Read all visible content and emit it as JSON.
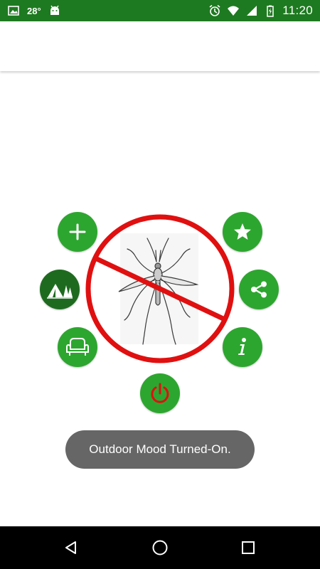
{
  "status_bar": {
    "temperature": "28°",
    "time": "11:20",
    "icons": [
      "image-icon",
      "android-icon",
      "alarm-icon",
      "wifi-icon",
      "signal-icon",
      "battery-icon"
    ]
  },
  "buttons": {
    "add": "plus-icon",
    "outdoor": "camp-tent-icon",
    "indoor": "armchair-icon",
    "power": "power-icon",
    "favorite": "star-icon",
    "share": "share-icon",
    "info": "info-icon"
  },
  "central_image": "no-mosquito-icon",
  "toast": {
    "message": "Outdoor Mood Turned-On."
  },
  "colors": {
    "status_bar": "#1e7a20",
    "button_green": "#2da62f",
    "button_selected": "#1e6b20",
    "prohibition_red": "#e01010",
    "toast_bg": "#666666"
  },
  "navigation": [
    "back-icon",
    "home-icon",
    "recents-icon"
  ]
}
